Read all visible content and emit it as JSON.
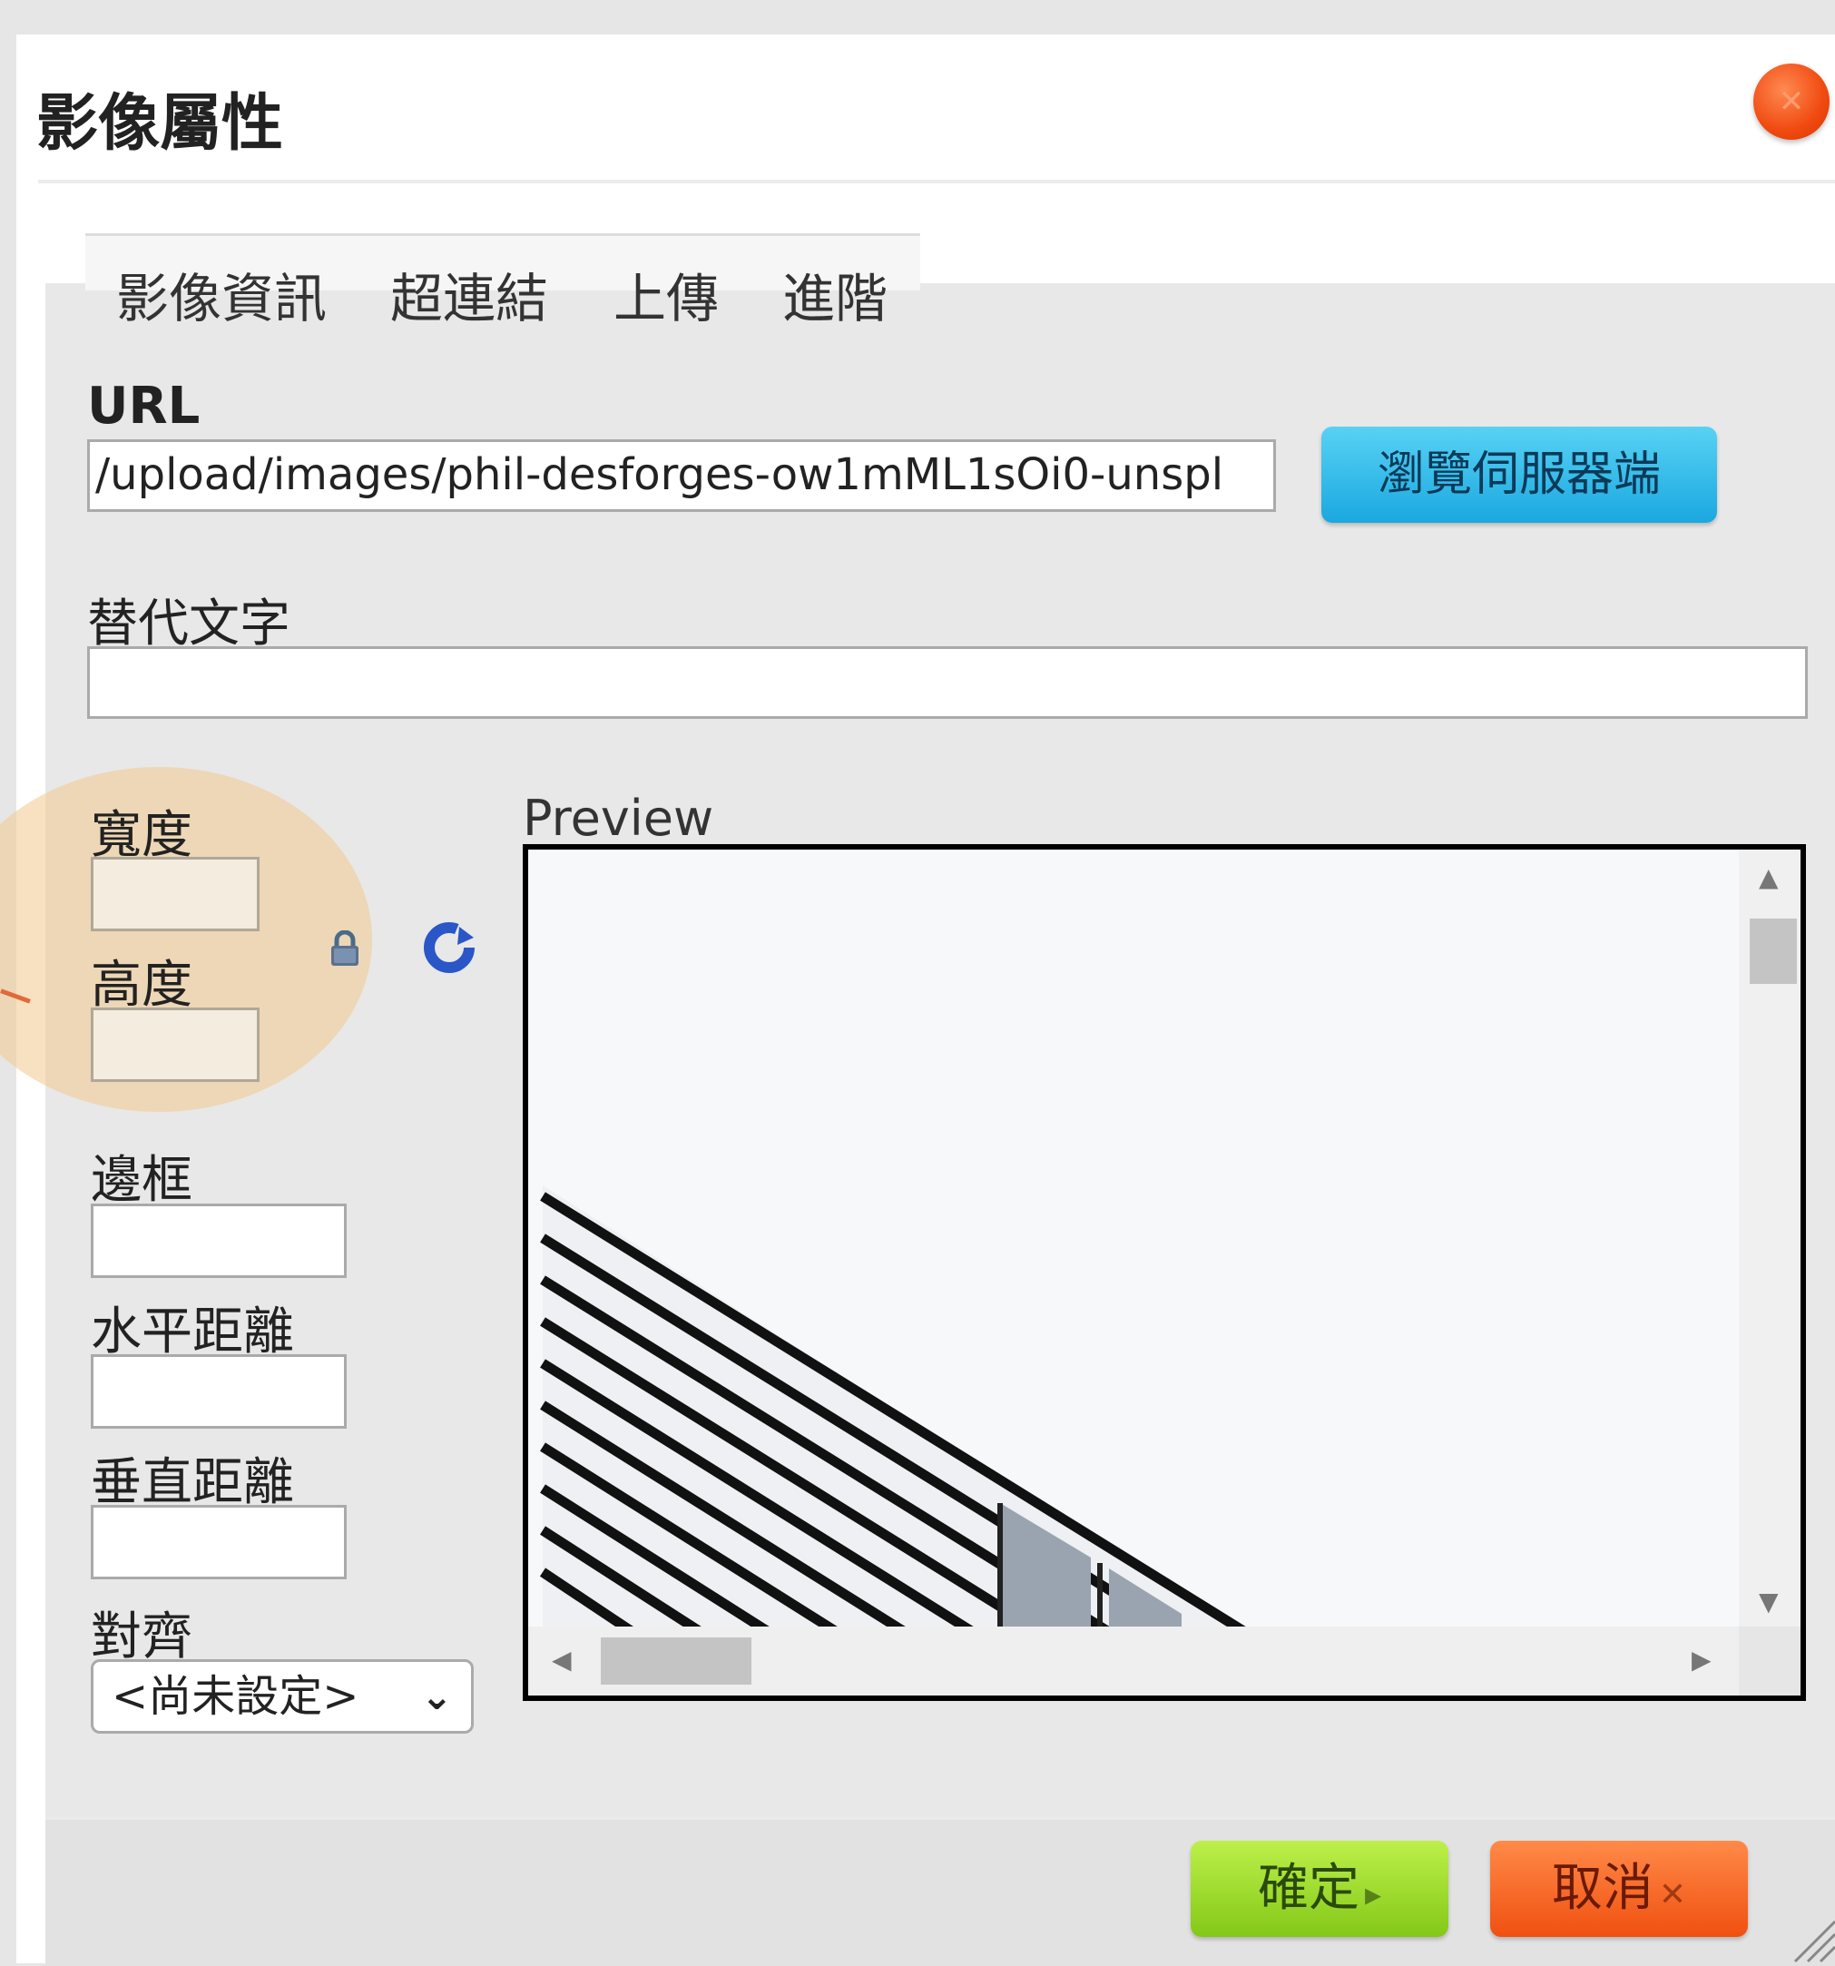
{
  "dialog": {
    "title": "影像屬性",
    "close_glyph": "✕"
  },
  "tabs": [
    "影像資訊",
    "超連結",
    "上傳",
    "進階"
  ],
  "form": {
    "url_label": "URL",
    "url_value": "/upload/images/phil-desforges-ow1mML1sOi0-unspl",
    "browse_label": "瀏覽伺服器端",
    "alt_label": "替代文字",
    "alt_value": "",
    "width_label": "寬度",
    "width_value": "",
    "height_label": "高度",
    "height_value": "",
    "border_label": "邊框",
    "border_value": "",
    "hspace_label": "水平距離",
    "hspace_value": "",
    "vspace_label": "垂直距離",
    "vspace_value": "",
    "align_label": "對齊",
    "align_selected": "<尚未設定>"
  },
  "preview": {
    "label": "Preview"
  },
  "footer": {
    "ok_label": "確定",
    "ok_glyph": "▸",
    "cancel_label": "取消",
    "cancel_glyph": "✕"
  },
  "colors": {
    "close_button": "#f04a10",
    "browse_button": "#1aa8e0",
    "ok_button": "#84c818",
    "cancel_button": "#f05010",
    "highlight": "#f0c88c"
  },
  "icons": [
    "close-icon",
    "lock-icon",
    "refresh-icon",
    "chevron-down-icon",
    "resize-grip-icon"
  ]
}
